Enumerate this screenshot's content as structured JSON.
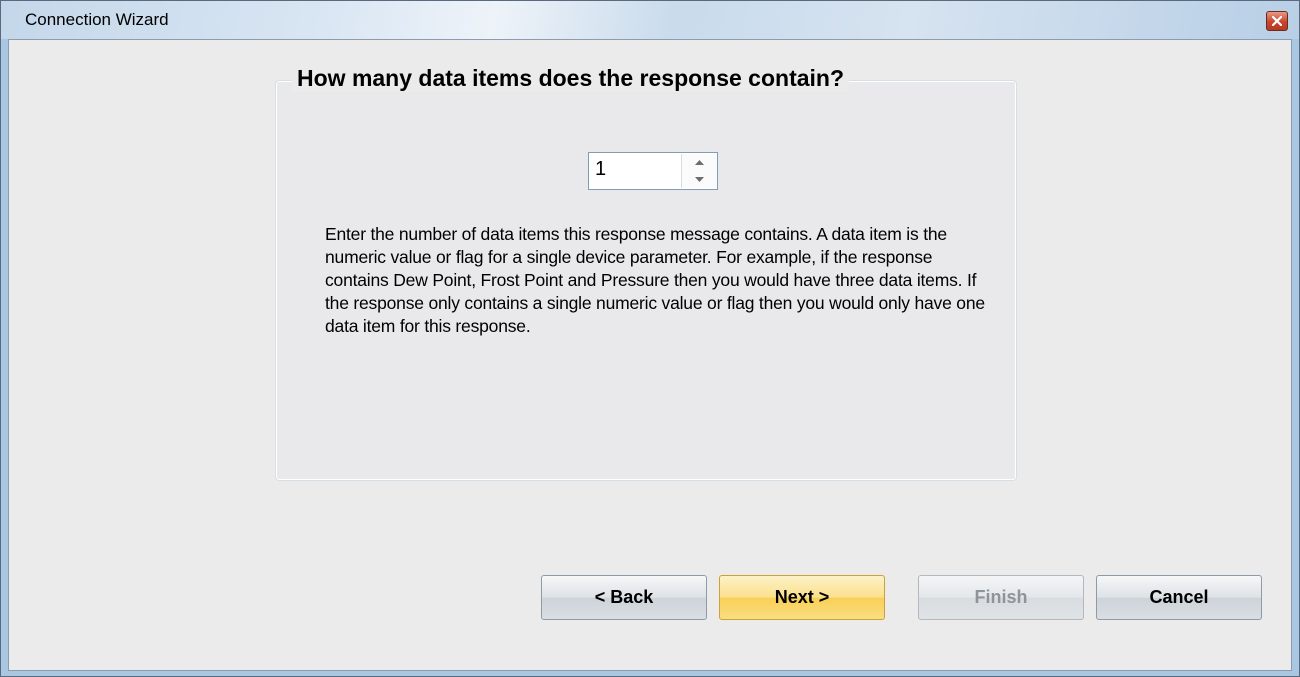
{
  "window": {
    "title": "Connection Wizard"
  },
  "group": {
    "heading": "How many data items does the response contain?"
  },
  "spinner": {
    "value": "1"
  },
  "description": "Enter the number of data items this response message contains.  A data item is the numeric value or flag for a single device parameter. For example, if the response contains Dew Point, Frost Point and Pressure then you would have three data items.  If the response only contains a single numeric value or flag then you would only have one data item for this response.",
  "buttons": {
    "back": "< Back",
    "next": "Next >",
    "finish": "Finish",
    "cancel": "Cancel"
  },
  "icons": {
    "close": "close-icon",
    "up": "spin-up-arrow-icon",
    "down": "spin-down-arrow-icon"
  }
}
